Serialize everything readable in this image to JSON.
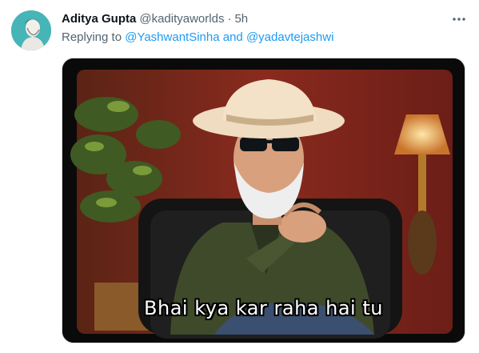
{
  "tweet": {
    "author_name": "Aditya Gupta",
    "author_handle": "@kadityaworlds",
    "separator": "·",
    "time": "5h",
    "more_icon": "more-horizontal-icon",
    "reply_prefix": "Replying to",
    "mention_1": "@YashwantSinha",
    "conjunction": "and",
    "mention_2": "@yadavtejashwi",
    "image_caption": "Bhai kya kar raha hai tu"
  },
  "colors": {
    "link": "#1d9bf0",
    "secondary_text": "#536471",
    "primary_text": "#0f1419"
  }
}
